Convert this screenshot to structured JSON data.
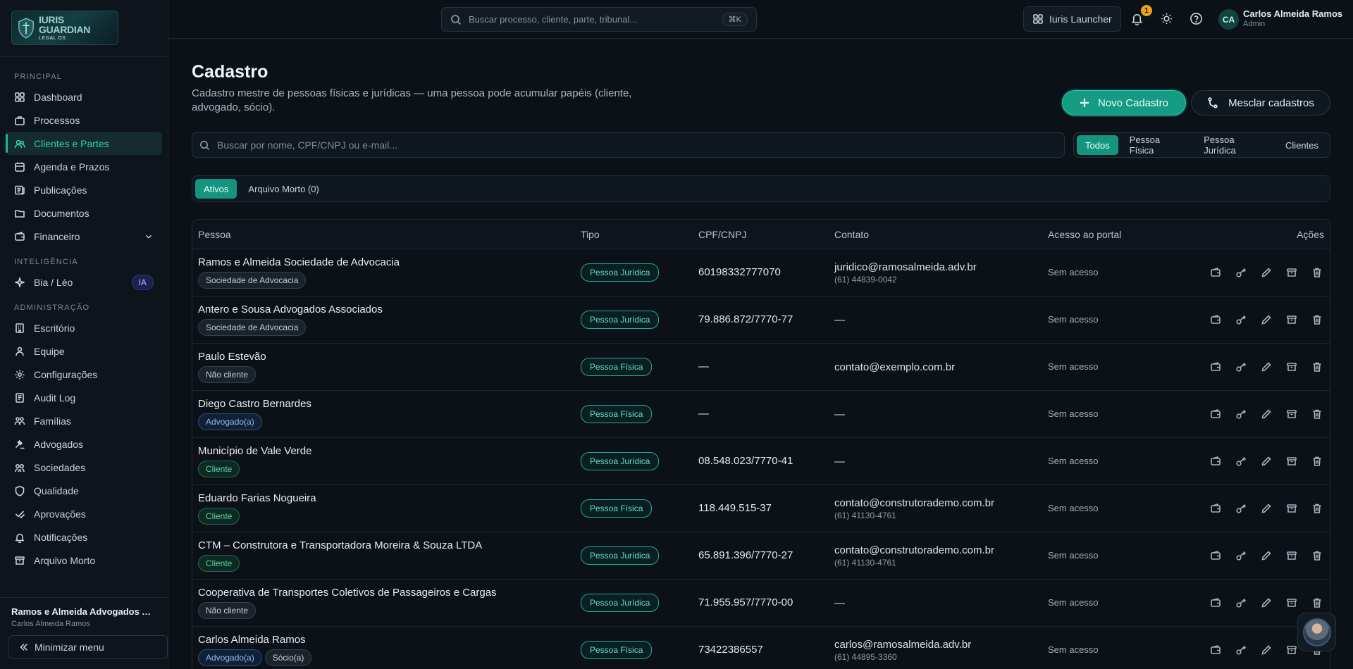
{
  "brand": {
    "logo_line1": "IURIS GUARDIAN",
    "logo_line2": "LEGAL OS"
  },
  "sidebar": {
    "sections": [
      {
        "title": "PRINCIPAL",
        "items": [
          {
            "label": "Dashboard",
            "icon": "grid-icon"
          },
          {
            "label": "Processos",
            "icon": "briefcase-icon"
          },
          {
            "label": "Clientes e Partes",
            "icon": "users-icon",
            "active": true
          },
          {
            "label": "Agenda e Prazos",
            "icon": "calendar-icon"
          },
          {
            "label": "Publicações",
            "icon": "newspaper-icon"
          },
          {
            "label": "Documentos",
            "icon": "folder-icon"
          },
          {
            "label": "Financeiro",
            "icon": "wallet-icon",
            "expandable": true
          }
        ]
      },
      {
        "title": "INTELIGÊNCIA",
        "items": [
          {
            "label": "Bia / Léo",
            "icon": "sparkle-icon",
            "badge": "IA"
          }
        ]
      },
      {
        "title": "ADMINISTRAÇÃO",
        "items": [
          {
            "label": "Escritório",
            "icon": "building-icon"
          },
          {
            "label": "Equipe",
            "icon": "team-icon"
          },
          {
            "label": "Configurações",
            "icon": "gear-icon"
          },
          {
            "label": "Audit Log",
            "icon": "log-icon"
          },
          {
            "label": "Famílias",
            "icon": "family-icon"
          },
          {
            "label": "Advogados",
            "icon": "gavel-icon"
          },
          {
            "label": "Sociedades",
            "icon": "society-icon"
          },
          {
            "label": "Qualidade",
            "icon": "shield-icon"
          },
          {
            "label": "Aprovações",
            "icon": "approval-icon"
          },
          {
            "label": "Notificações",
            "icon": "bell-icon"
          },
          {
            "label": "Arquivo Morto",
            "icon": "archive-icon"
          }
        ]
      }
    ],
    "footer": {
      "org": "Ramos e Almeida Advogados Associados",
      "user": "Carlos Almeida Ramos",
      "minimize_label": "Minimizar menu"
    }
  },
  "topbar": {
    "search_placeholder": "Buscar processo, cliente, parte, tribunal...",
    "shortcut": "⌘K",
    "launcher_label": "Iuris Launcher",
    "notifications_count": "1",
    "avatar_initials": "CA",
    "user_name": "Carlos Almeida Ramos",
    "user_role": "Admin"
  },
  "page": {
    "title": "Cadastro",
    "subtitle": "Cadastro mestre de pessoas físicas e jurídicas — uma pessoa pode acumular papéis (cliente, advogado, sócio).",
    "new_button": "Novo Cadastro",
    "merge_button": "Mesclar cadastros",
    "search_placeholder": "Buscar por nome, CPF/CNPJ ou e-mail...",
    "filters": [
      "Todos",
      "Pessoa Física",
      "Pessoa Jurídica",
      "Clientes"
    ],
    "active_filter": "Todos",
    "status_tabs": [
      "Ativos",
      "Arquivo Morto (0)"
    ],
    "active_status": "Ativos"
  },
  "table": {
    "headers": [
      "Pessoa",
      "Tipo",
      "CPF/CNPJ",
      "Contato",
      "Acesso ao portal",
      "Ações"
    ],
    "rows": [
      {
        "name": "Ramos e Almeida Sociedade de Advocacia",
        "tags": [
          {
            "label": "Sociedade de Advocacia",
            "kind": "neutral"
          }
        ],
        "tipo": "Pessoa Jurídica",
        "doc": "60198332777070",
        "email": "juridico@ramosalmeida.adv.br",
        "phone": "(61) 44839-0042",
        "portal": "Sem acesso"
      },
      {
        "name": "Antero e Sousa Advogados Associados",
        "tags": [
          {
            "label": "Sociedade de Advocacia",
            "kind": "neutral"
          }
        ],
        "tipo": "Pessoa Jurídica",
        "doc": "79.886.872/7770-77",
        "email": "—",
        "phone": "",
        "portal": "Sem acesso"
      },
      {
        "name": "Paulo Estevão",
        "tags": [
          {
            "label": "Não cliente",
            "kind": "neutral"
          }
        ],
        "tipo": "Pessoa Física",
        "doc": "—",
        "email": "contato@exemplo.com.br",
        "phone": "",
        "portal": "Sem acesso"
      },
      {
        "name": "Diego Castro Bernardes",
        "tags": [
          {
            "label": "Advogado(a)",
            "kind": "advogado"
          }
        ],
        "tipo": "Pessoa Física",
        "doc": "—",
        "email": "—",
        "phone": "",
        "portal": "Sem acesso"
      },
      {
        "name": "Município de Vale Verde",
        "tags": [
          {
            "label": "Cliente",
            "kind": "cliente"
          }
        ],
        "tipo": "Pessoa Jurídica",
        "doc": "08.548.023/7770-41",
        "email": "—",
        "phone": "",
        "portal": "Sem acesso"
      },
      {
        "name": "Eduardo Farias Nogueira",
        "tags": [
          {
            "label": "Cliente",
            "kind": "cliente"
          }
        ],
        "tipo": "Pessoa Física",
        "doc": "118.449.515-37",
        "email": "contato@construtorademo.com.br",
        "phone": "(61) 41130-4761",
        "portal": "Sem acesso"
      },
      {
        "name": "CTM – Construtora e Transportadora Moreira & Souza LTDA",
        "tags": [
          {
            "label": "Cliente",
            "kind": "cliente"
          }
        ],
        "tipo": "Pessoa Jurídica",
        "doc": "65.891.396/7770-27",
        "email": "contato@construtorademo.com.br",
        "phone": "(61) 41130-4761",
        "portal": "Sem acesso"
      },
      {
        "name": "Cooperativa de Transportes Coletivos de Passageiros e Cargas",
        "tags": [
          {
            "label": "Não cliente",
            "kind": "neutral"
          }
        ],
        "tipo": "Pessoa Jurídica",
        "doc": "71.955.957/7770-00",
        "email": "—",
        "phone": "",
        "portal": "Sem acesso"
      },
      {
        "name": "Carlos Almeida Ramos",
        "tags": [
          {
            "label": "Advogado(a)",
            "kind": "advogado"
          },
          {
            "label": "Sócio(a)",
            "kind": "neutral"
          }
        ],
        "tipo": "Pessoa Física",
        "doc": "73422386557",
        "email": "carlos@ramosalmeida.adv.br",
        "phone": "(61) 44895-3360",
        "portal": "Sem acesso"
      }
    ],
    "row_actions": [
      "wallet-icon",
      "key-icon",
      "edit-icon",
      "archive-icon",
      "trash-icon"
    ]
  },
  "colors": {
    "accent": "#15957f",
    "accent_light": "#2fd1b2",
    "background": "#0b1117",
    "notification": "#e8a21b"
  }
}
